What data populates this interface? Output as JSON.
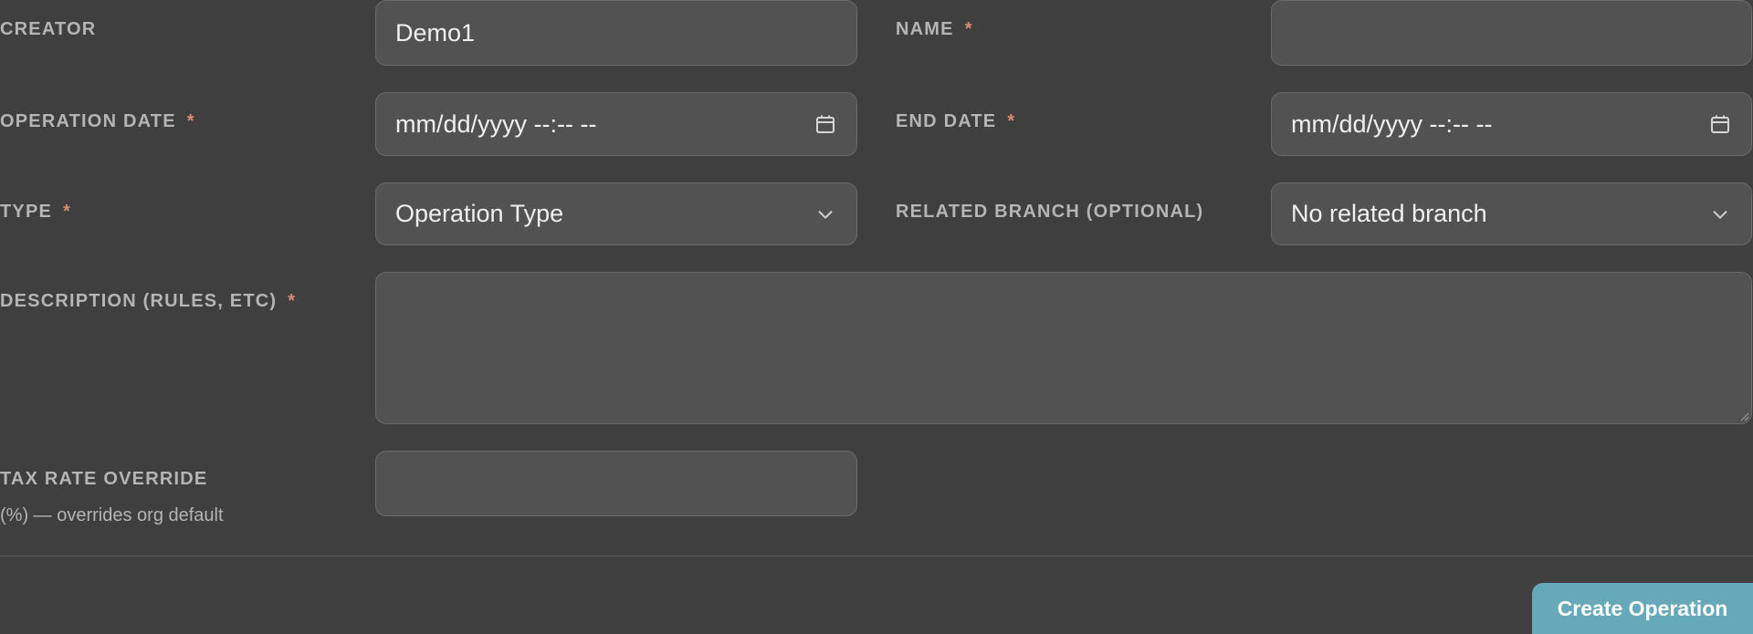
{
  "form": {
    "creator": {
      "label": "CREATOR",
      "value": "Demo1"
    },
    "name": {
      "label": "NAME",
      "required_mark": "*",
      "value": ""
    },
    "operation_date": {
      "label": "OPERATION DATE",
      "required_mark": "*",
      "placeholder": "mm/dd/yyyy --:-- --"
    },
    "end_date": {
      "label": "END DATE",
      "required_mark": "*",
      "placeholder": "mm/dd/yyyy --:-- --"
    },
    "type": {
      "label": "TYPE",
      "required_mark": "*",
      "selected": "Operation Type"
    },
    "related_branch": {
      "label": "RELATED BRANCH (OPTIONAL)",
      "selected": "No related branch"
    },
    "description": {
      "label": "DESCRIPTION (RULES, ETC)",
      "required_mark": "*",
      "value": ""
    },
    "tax_rate": {
      "label": "TAX RATE OVERRIDE",
      "hint": "(%) — overrides org default",
      "value": ""
    }
  },
  "actions": {
    "submit_label": "Create Operation"
  },
  "icons": {
    "calendar": "calendar-icon",
    "chevron": "chevron-down-icon"
  },
  "colors": {
    "background": "#3f3f3f",
    "field_bg": "#525252",
    "required": "#d88b72",
    "accent": "#67a9b8"
  }
}
